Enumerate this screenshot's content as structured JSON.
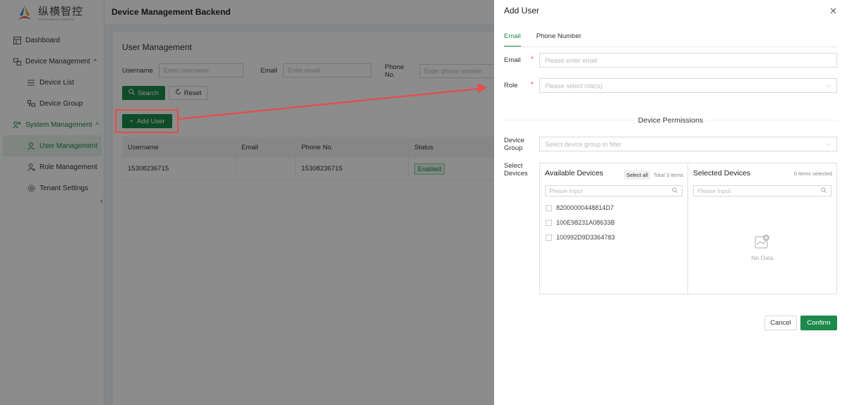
{
  "brand": {
    "name_cn": "纵横智控",
    "name_en": "INTELLIGENT CONTROL"
  },
  "header": {
    "title": "Device Management Backend"
  },
  "sidebar": {
    "items": [
      {
        "label": "Dashboard"
      },
      {
        "label": "Device Management"
      },
      {
        "label": "Device List"
      },
      {
        "label": "Device Group"
      },
      {
        "label": "System Management"
      },
      {
        "label": "User Management"
      },
      {
        "label": "Role Management"
      },
      {
        "label": "Tenant Settings"
      }
    ],
    "collapse_glyph": "‹"
  },
  "main": {
    "title": "User Management",
    "filters": [
      {
        "label": "Username",
        "placeholder": "Enter username"
      },
      {
        "label": "Email",
        "placeholder": "Enter email"
      },
      {
        "label": "Phone No.",
        "placeholder": "Enter phone number"
      }
    ],
    "search_label": "Search",
    "reset_label": "Reset",
    "add_user_label": "Add User",
    "table": {
      "headers": [
        "Username",
        "Email",
        "Phone No.",
        "Status"
      ],
      "rows": [
        {
          "username": "15308236715",
          "email": "",
          "phone": "15308236715",
          "status": "Enabled"
        }
      ]
    }
  },
  "drawer": {
    "title": "Add User",
    "close_glyph": "✕",
    "tabs": [
      "Email",
      "Phone Number"
    ],
    "email_label": "Email",
    "email_placeholder": "Please enter email",
    "role_label": "Role",
    "role_placeholder": "Please select role(s)",
    "section_title": "Device Permissions",
    "group_label_1": "Device",
    "group_label_2": "Group",
    "group_placeholder": "Select device group to filter",
    "select_label_1": "Select",
    "select_label_2": "Devices",
    "available": {
      "title": "Available Devices",
      "select_all": "Select all",
      "total": "Total 3 items",
      "search_placeholder": "Please Input",
      "items": [
        "82000000448814D7",
        "100E98231A08633B",
        "100992D9D3364783"
      ]
    },
    "selected": {
      "title": "Selected Devices",
      "count": "0 items selected",
      "search_placeholder": "Please Input",
      "empty_text": "No Data"
    },
    "cancel_label": "Cancel",
    "confirm_label": "Confirm"
  },
  "colors": {
    "accent": "#1d8a4b",
    "annotation": "#e84c4c"
  }
}
